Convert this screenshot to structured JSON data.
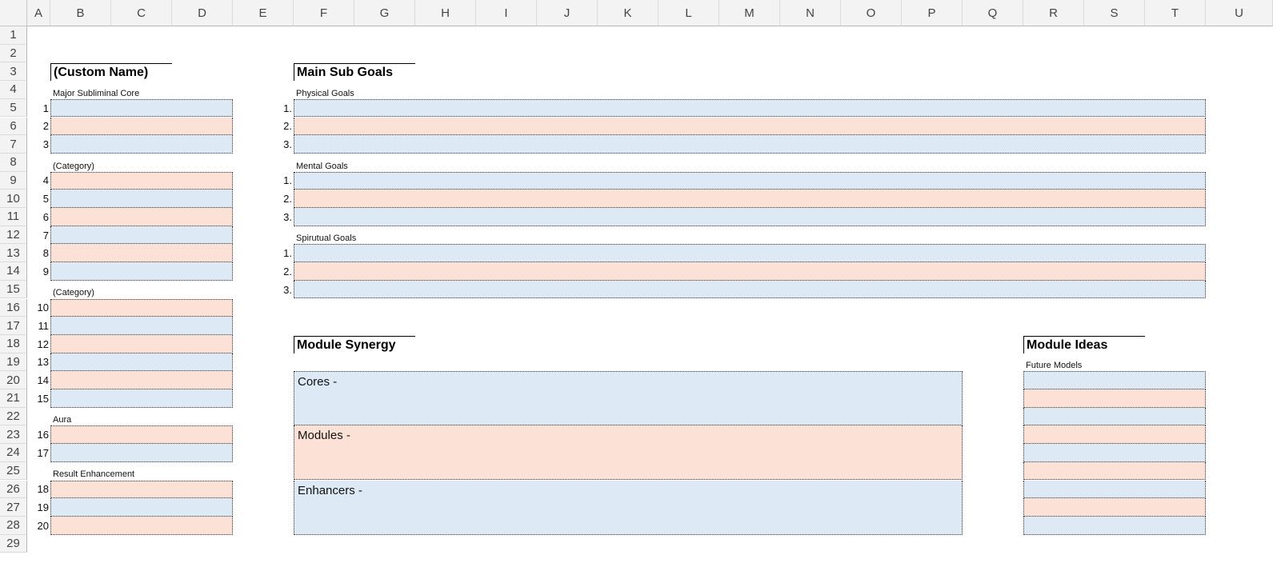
{
  "columns": [
    "A",
    "B",
    "C",
    "D",
    "E",
    "F",
    "G",
    "H",
    "I",
    "J",
    "K",
    "L",
    "M",
    "N",
    "O",
    "P",
    "Q",
    "R",
    "S",
    "T",
    "U"
  ],
  "rows": [
    "1",
    "2",
    "3",
    "4",
    "5",
    "6",
    "7",
    "8",
    "9",
    "10",
    "11",
    "12",
    "13",
    "14",
    "15",
    "16",
    "17",
    "18",
    "19",
    "20",
    "21",
    "22",
    "23",
    "24",
    "25",
    "26",
    "27",
    "28",
    "29"
  ],
  "left": {
    "title": "(Custom Name)",
    "section1_label": "Major Subliminal Core",
    "section1_numbers": [
      "1",
      "2",
      "3"
    ],
    "section2_label": "(Category)",
    "section2_numbers": [
      "4",
      "5",
      "6",
      "7",
      "8",
      "9"
    ],
    "section3_label": "(Category)",
    "section3_numbers": [
      "10",
      "11",
      "12",
      "13",
      "14",
      "15"
    ],
    "section4_label": "Aura",
    "section4_numbers": [
      "16",
      "17"
    ],
    "section5_label": "Result Enhancement",
    "section5_numbers": [
      "18",
      "19",
      "20"
    ]
  },
  "main_goals": {
    "title": "Main Sub Goals",
    "physical_label": "Physical Goals",
    "mental_label": "Mental Goals",
    "spiritual_label": "Spirutual Goals",
    "numbers": [
      "1.",
      "2.",
      "3."
    ]
  },
  "synergy": {
    "title": "Module Synergy",
    "cores_label": "Cores -",
    "modules_label": "Modules -",
    "enhancers_label": "Enhancers -"
  },
  "ideas": {
    "title": "Module Ideas",
    "future_label": "Future Models"
  },
  "colors": {
    "blue_fill": "#dde9f5",
    "peach_fill": "#fce2d6",
    "header_bg": "#f3f3f3"
  }
}
